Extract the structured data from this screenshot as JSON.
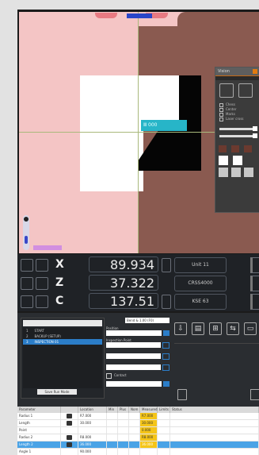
{
  "viewer": {
    "cyan_label": "Ⅲ 000"
  },
  "float_panel": {
    "title": "Vision",
    "subtitle": "",
    "options": [
      "Chess",
      "Center",
      "Marks",
      "Laser cross"
    ]
  },
  "dro": {
    "rows": [
      {
        "axis": "X",
        "value": "89.934",
        "info": "Unit 11"
      },
      {
        "axis": "Z",
        "value": "37.322",
        "info": "CRSS4000"
      },
      {
        "axis": "C",
        "value": "137.51",
        "info": "KSE 63"
      }
    ]
  },
  "tool_panel": {
    "rows": [
      {
        "id": "1",
        "name": "START"
      },
      {
        "id": "2",
        "name": "BACKUP (SETUP)"
      },
      {
        "id": "3",
        "name": "INSPECTION 01"
      }
    ],
    "button": "Save Run Mode"
  },
  "controls": {
    "field1": "Bend & 1.00 (F0)",
    "label1": "Position",
    "label2": "Inspection Point",
    "small": "Contact"
  },
  "right_icons": [
    "⇩",
    "▤",
    "⊞",
    "⇆",
    "▭"
  ],
  "table": {
    "headers": [
      "Parameter",
      "",
      "Location",
      "Min",
      "Plus",
      "Nom",
      "Measured",
      "Limits",
      "Status"
    ],
    "rows": [
      {
        "name": "Radius 1",
        "loc": "R7.000",
        "meas": "R7.000",
        "blk": true,
        "sel": false
      },
      {
        "name": "Length",
        "loc": "30.000",
        "meas": "30.000",
        "blk": false,
        "sel": false
      },
      {
        "name": "Point",
        "loc": "",
        "meas": "0.000",
        "blk": false,
        "sel": false
      },
      {
        "name": "Radius 2",
        "loc": "R8.000",
        "meas": "R8.000",
        "blk": true,
        "sel": false
      },
      {
        "name": "Length 2",
        "loc": "36.000",
        "meas": "36.000",
        "blk": true,
        "sel": true
      },
      {
        "name": "Angle 1",
        "loc": "90.000",
        "meas": "",
        "blk": false,
        "sel": false
      }
    ]
  }
}
